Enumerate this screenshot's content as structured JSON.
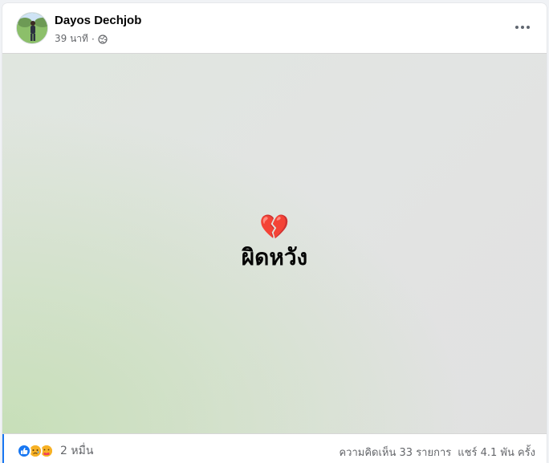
{
  "post": {
    "author": "Dayos Dechjob",
    "time": "39 นาที",
    "separator": "·",
    "privacy_icon": "globe-icon",
    "more_icon": "more-options-icon",
    "emoji": "💔",
    "message": "ผิดหวัง"
  },
  "footer": {
    "reaction_icons": [
      "like-icon",
      "sad-icon",
      "care-icon"
    ],
    "reaction_count": "2 หมื่น",
    "comments": "ความคิดเห็น 33 รายการ",
    "shares": "แชร์ 4.1 พัน ครั้ง"
  },
  "colors": {
    "accent": "#1877f2",
    "text_primary": "#050505",
    "text_secondary": "#65676b",
    "post_background_green": "#c7dfb8",
    "post_background_gray": "#e1e1e1"
  }
}
